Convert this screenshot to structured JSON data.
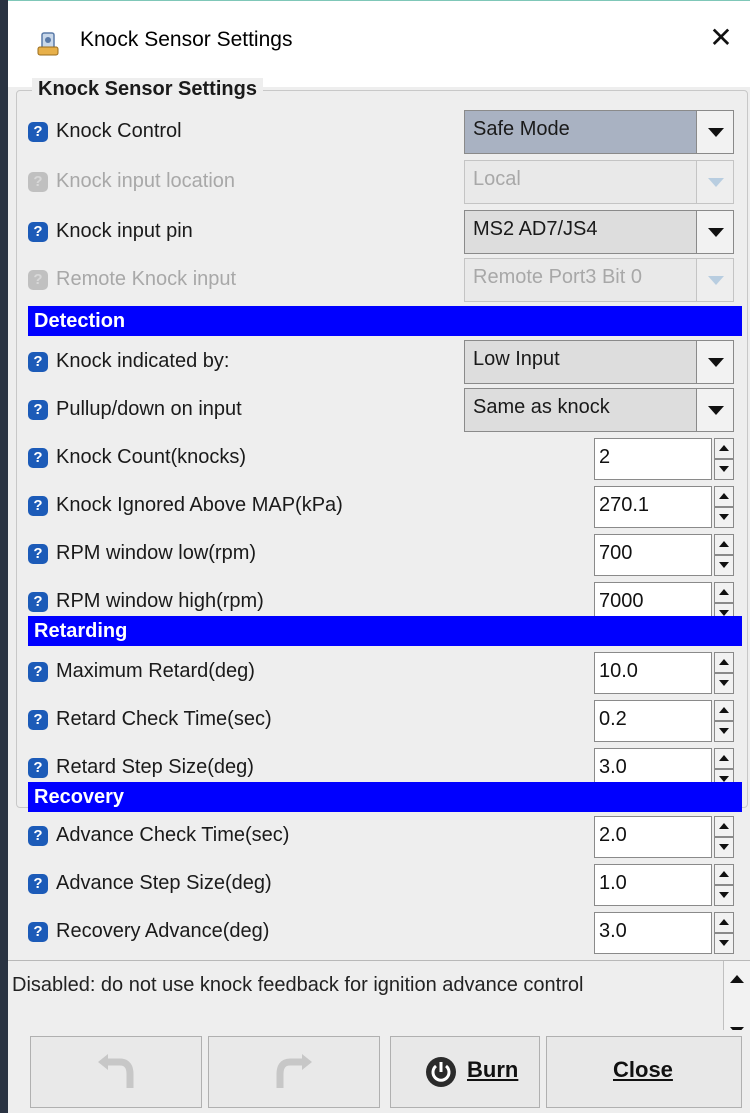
{
  "window": {
    "title": "Knock Sensor Settings",
    "close_glyph": "✕",
    "group_title": "Knock Sensor Settings"
  },
  "colors": {
    "section_bg": "#0000ff",
    "help_icon": "#1c5bb8",
    "combo_selected": "#a9b2c2"
  },
  "settings": {
    "knock_control": {
      "label": "Knock Control",
      "value": "Safe Mode"
    },
    "knock_input_location": {
      "label": "Knock input location",
      "value": "Local"
    },
    "knock_input_pin": {
      "label": "Knock input pin",
      "value": "MS2 AD7/JS4"
    },
    "remote_knock_input": {
      "label": "Remote Knock input",
      "value": "Remote Port3 Bit 0"
    }
  },
  "detection": {
    "header": "Detection",
    "knock_indicated_by": {
      "label": "Knock indicated by:",
      "value": "Low Input"
    },
    "pullup_down": {
      "label": "Pullup/down on input",
      "value": "Same as knock"
    },
    "knock_count": {
      "label": "Knock Count(knocks)",
      "value": "2"
    },
    "knock_ignored_above_map": {
      "label": "Knock Ignored Above MAP(kPa)",
      "value": "270.1"
    },
    "rpm_window_low": {
      "label": "RPM window low(rpm)",
      "value": "700"
    },
    "rpm_window_high": {
      "label": "RPM window high(rpm)",
      "value": "7000"
    }
  },
  "retarding": {
    "header": "Retarding",
    "maximum_retard": {
      "label": "Maximum Retard(deg)",
      "value": "10.0"
    },
    "retard_check_time": {
      "label": "Retard Check Time(sec)",
      "value": "0.2"
    },
    "retard_step_size": {
      "label": "Retard Step Size(deg)",
      "value": "3.0"
    }
  },
  "recovery": {
    "header": "Recovery",
    "advance_check_time": {
      "label": "Advance Check Time(sec)",
      "value": "2.0"
    },
    "advance_step_size": {
      "label": "Advance Step Size(deg)",
      "value": "1.0"
    },
    "recovery_advance": {
      "label": "Recovery Advance(deg)",
      "value": "3.0"
    }
  },
  "status": {
    "text": "Disabled: do not use knock feedback for ignition advance control"
  },
  "buttons": {
    "burn": "Burn",
    "close": "Close"
  },
  "icons": {
    "help": "help-icon",
    "undo": "undo-icon",
    "redo": "redo-icon",
    "burn": "power-icon",
    "app": "app-icon"
  }
}
